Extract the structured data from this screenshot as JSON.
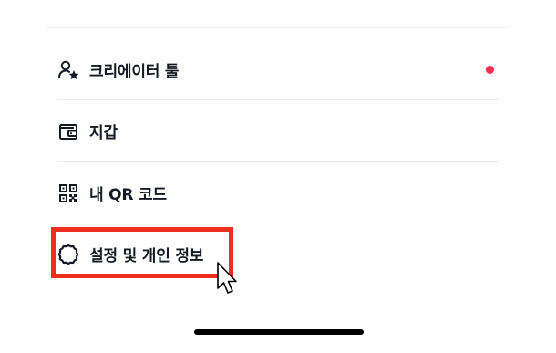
{
  "menu": {
    "items": [
      {
        "label": "크리에이터 툴",
        "icon": "creator-tools-icon",
        "has_dot": true
      },
      {
        "label": "지갑",
        "icon": "wallet-icon"
      },
      {
        "label": "내 QR 코드",
        "icon": "qr-code-icon"
      },
      {
        "label": "설정 및 개인 정보",
        "icon": "settings-gear-icon",
        "highlighted": true
      }
    ]
  },
  "colors": {
    "notification_dot": "#fe2c55",
    "highlight_border": "#ef2e1e",
    "text": "#161823"
  }
}
